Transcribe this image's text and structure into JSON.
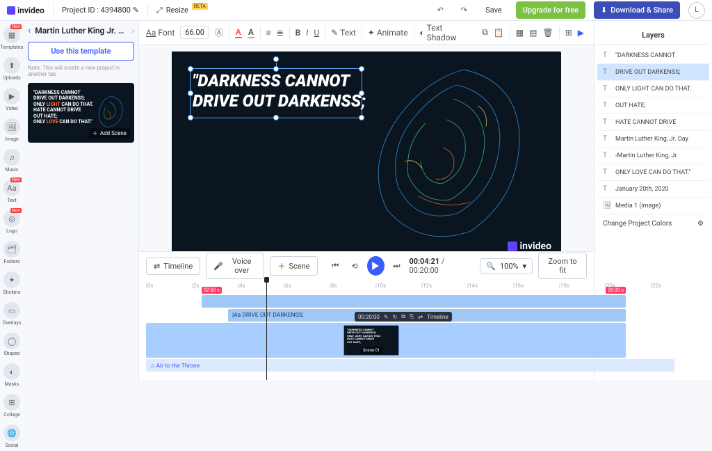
{
  "header": {
    "brand": "invideo",
    "project_label": "Project ID : 4394800",
    "resize": "Resize",
    "beta_tag": "BETA",
    "save": "Save",
    "upgrade": "Upgrade for free",
    "download": "Download & Share",
    "user_initial": "L"
  },
  "leftrail": [
    {
      "label": "Templates",
      "new": true
    },
    {
      "label": "Uploads"
    },
    {
      "label": "Video"
    },
    {
      "label": "Image"
    },
    {
      "label": "Music"
    },
    {
      "label": "Text",
      "new": true
    },
    {
      "label": "Logo",
      "new": true
    },
    {
      "label": "Folders"
    },
    {
      "label": "Stickers"
    },
    {
      "label": "Overlays"
    },
    {
      "label": "Shapes"
    },
    {
      "label": "Masks"
    },
    {
      "label": "Collage"
    },
    {
      "label": "Social"
    }
  ],
  "leftpanel": {
    "title": "Martin Luther King Jr. Day ...",
    "use_btn": "Use this template",
    "note": "Note: This will create a new project in another tab",
    "thumb_lines": "\"DARKNESS CANNOT\nDRIVE OUT DARKENSS;\nONLY <b>LIGHT</b> CAN DO THAT.\nHATE CANNOT DRIVE\nOUT HATE;\nONLY <b>LOVE</b> CAN DO THAT.\"",
    "add_scene": "Add Scene"
  },
  "toolbar": {
    "font_btn": "Font",
    "font_size": "66.00",
    "text_btn": "Text",
    "animate_btn": "Animate",
    "shadow_btn": "Text Shadow"
  },
  "canvas": {
    "line1": "\"DARKNESS CANNOT",
    "line2": "DRIVE OUT DARKENSS;",
    "watermark": "invideo"
  },
  "layers": {
    "title": "Layers",
    "items": [
      {
        "t": "T",
        "label": "\"DARKNESS CANNOT"
      },
      {
        "t": "T",
        "label": "DRIVE OUT DARKENSS;",
        "sel": true
      },
      {
        "t": "T",
        "label": "ONLY LIGHT CAN DO THAT."
      },
      {
        "t": "T",
        "label": "OUT HATE;"
      },
      {
        "t": "T",
        "label": "HATE CANNOT DRIVE"
      },
      {
        "t": "T",
        "label": "Martin Luther King, Jr. Day"
      },
      {
        "t": "T",
        "label": "-Martin Luther King, Jr."
      },
      {
        "t": "T",
        "label": "ONLY LOVE CAN DO THAT.\""
      },
      {
        "t": "T",
        "label": "January 20th, 2020"
      },
      {
        "t": "I",
        "label": "Media 1 (image)"
      }
    ],
    "colors": "Change Project Colors"
  },
  "timeline": {
    "timeline_btn": "Timeline",
    "voiceover_btn": "Voice over",
    "scene_btn": "Scene",
    "current": "00:04:21",
    "total": "00:20:00",
    "zoom": "100%",
    "fit": "Zoom to fit",
    "ticks": [
      "|0s",
      "|2s",
      "|4s",
      "|6s",
      "|8s",
      "|10s",
      "|12s",
      "|14s",
      "|16s",
      "|18s",
      "|20s",
      "|22s"
    ],
    "tag_in": "02:60 s",
    "tag_out": "20:00 s",
    "text_clip": "Aa DRIVE OUT DARKENSS;",
    "scene_toolbar": {
      "dur": "00:20:00",
      "tl": "Timeline"
    },
    "scene_label": "Scene 01",
    "audio_clip": "♫ Air to the Throne"
  }
}
